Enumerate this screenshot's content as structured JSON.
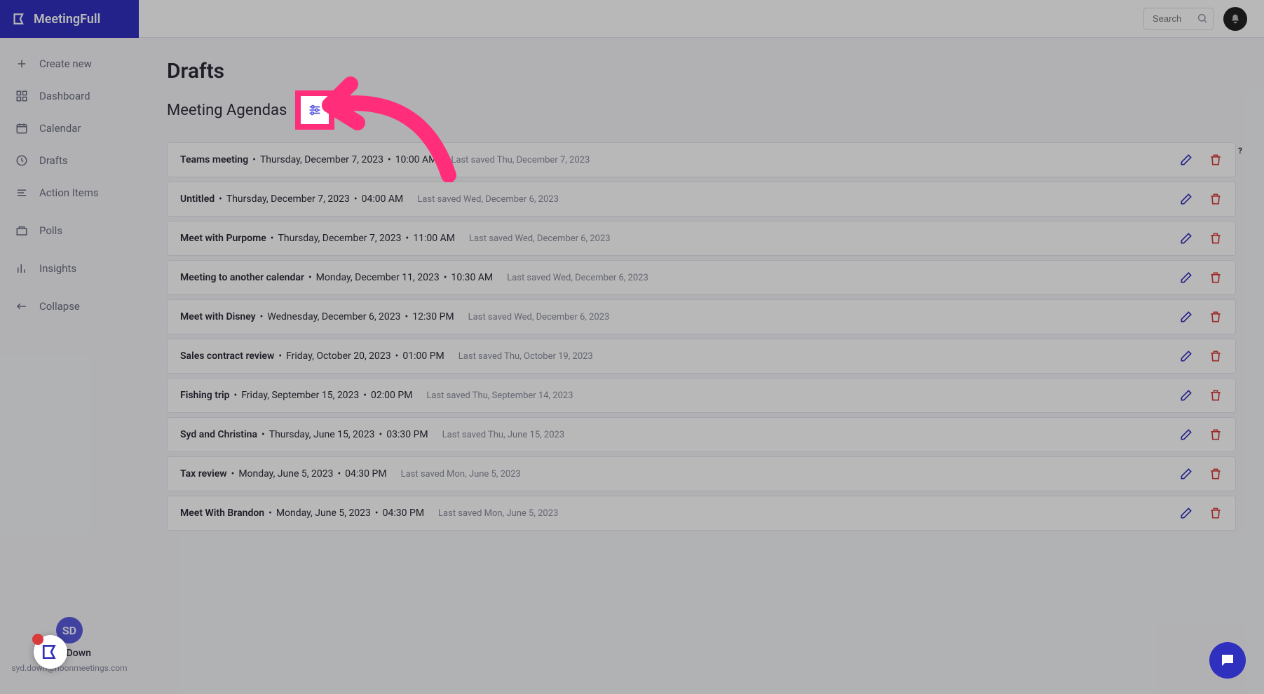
{
  "brand": "MeetingFull",
  "search": {
    "placeholder": "Search"
  },
  "nav": {
    "create": "Create new",
    "dashboard": "Dashboard",
    "calendar": "Calendar",
    "drafts": "Drafts",
    "action_items": "Action Items",
    "polls": "Polls",
    "insights": "Insights",
    "collapse": "Collapse"
  },
  "user": {
    "name": "Syd Down",
    "email": "syd.down@noonmeetings.com",
    "avatar_initials": "SD"
  },
  "page": {
    "title": "Drafts",
    "subtitle": "Meeting Agendas"
  },
  "rows": [
    {
      "title": "Teams meeting",
      "date": "Thursday, December 7, 2023",
      "time": "10:00 AM",
      "saved": "Last saved Thu, December 7, 2023"
    },
    {
      "title": "Untitled",
      "date": "Thursday, December 7, 2023",
      "time": "04:00 AM",
      "saved": "Last saved Wed, December 6, 2023"
    },
    {
      "title": "Meet with Purpome",
      "date": "Thursday, December 7, 2023",
      "time": "11:00 AM",
      "saved": "Last saved Wed, December 6, 2023"
    },
    {
      "title": "Meeting to another calendar",
      "date": "Monday, December 11, 2023",
      "time": "10:30 AM",
      "saved": "Last saved Wed, December 6, 2023"
    },
    {
      "title": "Meet with Disney",
      "date": "Wednesday, December 6, 2023",
      "time": "12:30 PM",
      "saved": "Last saved Wed, December 6, 2023"
    },
    {
      "title": "Sales contract review",
      "date": "Friday, October 20, 2023",
      "time": "01:00 PM",
      "saved": "Last saved Thu, October 19, 2023"
    },
    {
      "title": "Fishing trip",
      "date": "Friday, September 15, 2023",
      "time": "02:00 PM",
      "saved": "Last saved Thu, September 14, 2023"
    },
    {
      "title": "Syd and Christina",
      "date": "Thursday, June 15, 2023",
      "time": "03:30 PM",
      "saved": "Last saved Thu, June 15, 2023"
    },
    {
      "title": "Tax review",
      "date": "Monday, June 5, 2023",
      "time": "04:30 PM",
      "saved": "Last saved Mon, June 5, 2023"
    },
    {
      "title": "Meet With Brandon",
      "date": "Monday, June 5, 2023",
      "time": "04:30 PM",
      "saved": "Last saved Mon, June 5, 2023"
    }
  ]
}
